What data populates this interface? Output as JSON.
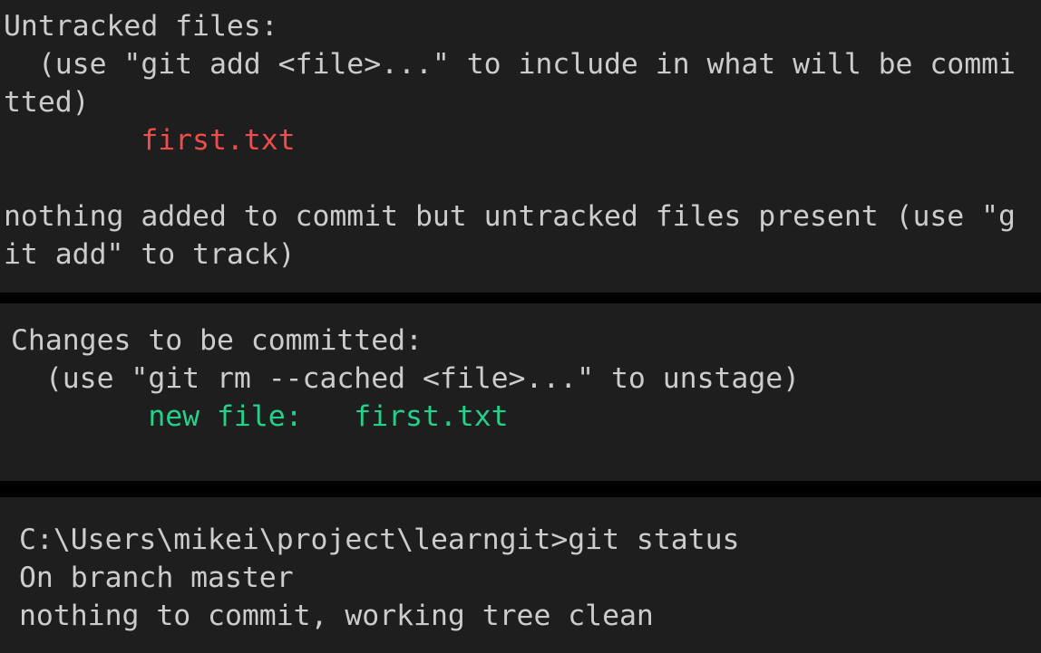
{
  "terminal": {
    "background_color": "#1e1e1e",
    "separator_color": "#000000",
    "default_text_color": "#cccccc",
    "untracked_color": "#f14c4c",
    "staged_color": "#23d18b"
  },
  "panels": [
    {
      "name": "untracked-files-output",
      "lines": [
        {
          "text": "Untracked files:",
          "color": "default"
        },
        {
          "text": "  (use \"git add <file>...\" to include in what will be commi",
          "color": "default"
        },
        {
          "text": "tted)",
          "color": "default"
        },
        {
          "text": "        first.txt",
          "color": "red"
        },
        {
          "text": " ",
          "color": "blank"
        },
        {
          "text": "nothing added to commit but untracked files present (use \"g",
          "color": "default"
        },
        {
          "text": "it add\" to track)",
          "color": "default"
        }
      ]
    },
    {
      "name": "changes-to-be-committed-output",
      "lines": [
        {
          "text": "Changes to be committed:",
          "color": "default"
        },
        {
          "text": "  (use \"git rm --cached <file>...\" to unstage)",
          "color": "default"
        },
        {
          "text": "        new file:   first.txt",
          "color": "green"
        }
      ]
    },
    {
      "name": "clean-tree-output",
      "lines": [
        {
          "text": "C:\\Users\\mikei\\project\\learngit>git status",
          "color": "default"
        },
        {
          "text": "On branch master",
          "color": "default"
        },
        {
          "text": "nothing to commit, working tree clean",
          "color": "default"
        }
      ]
    }
  ],
  "prompt": {
    "path": "C:\\Users\\mikei\\project\\learngit",
    "separator": ">",
    "command": "git status"
  },
  "git": {
    "branch": "master",
    "untracked_file": "first.txt",
    "staged_file": "first.txt",
    "staged_status": "new file:"
  }
}
